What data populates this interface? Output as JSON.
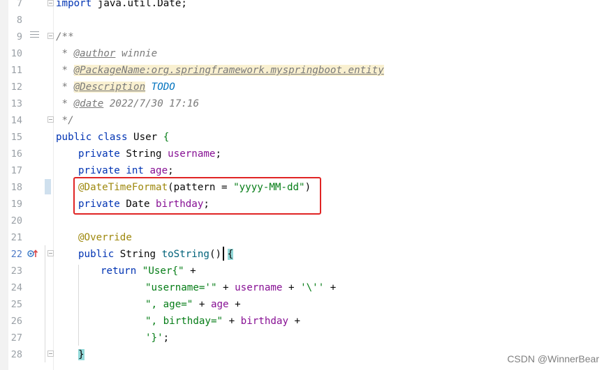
{
  "editor": {
    "line_numbers": [
      "7",
      "8",
      "9",
      "10",
      "11",
      "12",
      "13",
      "14",
      "15",
      "16",
      "17",
      "18",
      "19",
      "20",
      "21",
      "22",
      "23",
      "24",
      "25",
      "26",
      "27",
      "28"
    ],
    "active_line": "22",
    "lines": {
      "l7": {
        "kw": "import",
        "rest": " java.util.Date;"
      },
      "l9": {
        "text": "/**"
      },
      "l10": {
        "prefix": " * ",
        "tag": "@author",
        "rest": " winnie"
      },
      "l11": {
        "prefix": " * ",
        "tag": "@PackageName:org.springframework.myspringboot.entity"
      },
      "l12": {
        "prefix": " * ",
        "tag": "@Description",
        "todo": "TODO"
      },
      "l13": {
        "prefix": " * ",
        "tag": "@date",
        "rest": " 2022/7/30 17:16"
      },
      "l14": {
        "text": " */"
      },
      "l15": {
        "kw": "public class",
        "rest": " User ",
        "brace": "{"
      },
      "l16": {
        "kw": "private",
        "type": " String ",
        "field": "username",
        "end": ";"
      },
      "l17": {
        "kw": "private int",
        "field": " age",
        "end": ";"
      },
      "l18": {
        "ann": "@DateTimeFormat",
        "rest": "(pattern = ",
        "str": "\"yyyy-MM-dd\"",
        "end": ")"
      },
      "l19": {
        "kw": "private",
        "type": " Date ",
        "field": "birthday",
        "end": ";"
      },
      "l21": {
        "ann": "@Override"
      },
      "l22": {
        "kw": "public",
        "type": " String ",
        "fn": "toString",
        "rest": "() ",
        "brace": "{"
      },
      "l23": {
        "kw": "return",
        "str": " \"User{\"",
        "rest": " +"
      },
      "l24": {
        "str": "\"username='\"",
        "op1": " + ",
        "field": "username",
        "op2": " + ",
        "str2": "'\\''",
        "op3": " +"
      },
      "l25": {
        "str": "\", age=\"",
        "op1": " + ",
        "field": "age",
        "op2": " +"
      },
      "l26": {
        "str": "\", birthday=\"",
        "op1": " + ",
        "field": "birthday",
        "op2": " +"
      },
      "l27": {
        "str": "'}'",
        "end": ";"
      },
      "l28": {
        "brace": "}"
      }
    }
  },
  "watermark": "CSDN @WinnerBear",
  "colors": {
    "keyword": "#0033b3",
    "annotation": "#9e880d",
    "field": "#871094",
    "string": "#067d17",
    "comment": "#7a7a7a",
    "highlight_box": "#e02424"
  }
}
